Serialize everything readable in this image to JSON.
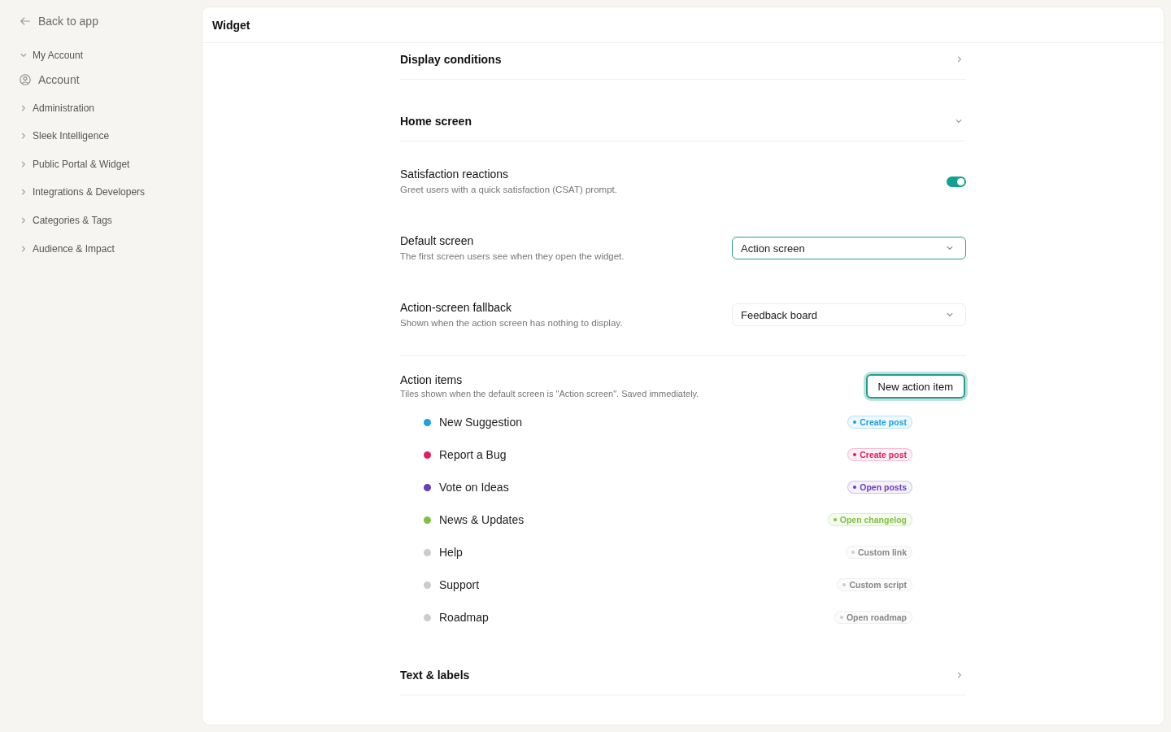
{
  "sidebar": {
    "back_link": "Back to app",
    "groups": [
      {
        "label": "My Account",
        "expanded": true,
        "children": [
          {
            "label": "Account"
          }
        ]
      },
      {
        "label": "Administration",
        "expanded": false
      },
      {
        "label": "Sleek Intelligence",
        "expanded": false
      },
      {
        "label": "Public Portal & Widget",
        "expanded": false
      },
      {
        "label": "Integrations & Developers",
        "expanded": false
      },
      {
        "label": "Categories & Tags",
        "expanded": false
      },
      {
        "label": "Audience & Impact",
        "expanded": false
      }
    ]
  },
  "panel": {
    "title": "Widget",
    "sections": [
      {
        "title": "Display conditions",
        "expanded": false
      },
      {
        "title": "Home screen",
        "expanded": true,
        "settings": [
          {
            "kind": "toggle",
            "title": "Satisfaction reactions",
            "description": "Greet users with a quick satisfaction (CSAT) prompt.",
            "on": true
          },
          {
            "kind": "select",
            "title": "Default screen",
            "description": "The first screen users see when they open the widget.",
            "value": "Action screen",
            "focused": true
          },
          {
            "kind": "select",
            "title": "Action-screen fallback",
            "description": "Shown when the action screen has nothing to display.",
            "value": "Feedback board",
            "focused": false
          }
        ],
        "action_items": {
          "title": "Action items",
          "description": "Tiles shown when the default screen is \"Action screen\". Saved immediately.",
          "button": {
            "label": "New action item",
            "focused": true
          },
          "items": [
            {
              "label": "New Suggestion",
              "color": "#1aa1e2",
              "action": "Create post"
            },
            {
              "label": "Report a Bug",
              "color": "#e0205e",
              "action": "Create post"
            },
            {
              "label": "Vote on Ideas",
              "color": "#6a3db8",
              "action": "Open posts"
            },
            {
              "label": "News & Updates",
              "color": "#7fc241",
              "action": "Open changelog"
            },
            {
              "label": "Help",
              "color": "#cccccc",
              "action": "Custom link"
            },
            {
              "label": "Support",
              "color": "#cccccc",
              "action": "Custom script"
            },
            {
              "label": "Roadmap",
              "color": "#cccccc",
              "action": "Open roadmap"
            }
          ]
        }
      },
      {
        "title": "Text & labels",
        "expanded": false
      }
    ]
  }
}
